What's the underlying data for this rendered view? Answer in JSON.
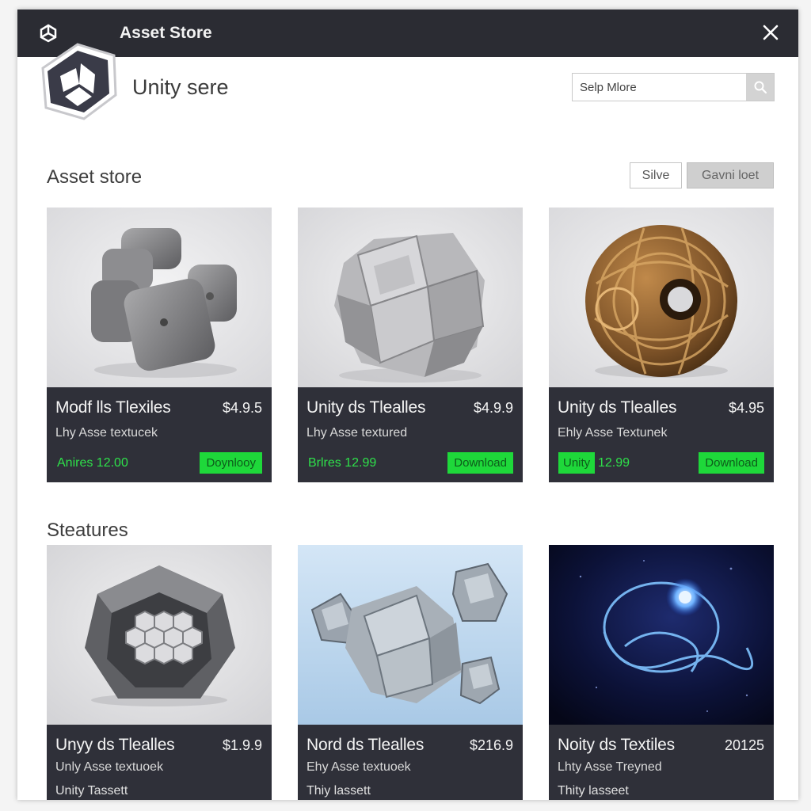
{
  "window": {
    "title": "Asset Store"
  },
  "header": {
    "brand": "Unity sere",
    "search_placeholder": "Selp Mlore"
  },
  "section1": {
    "title": "Asset store",
    "save_label": "Silve",
    "alt_label": "Gavni loet",
    "cards": [
      {
        "name": "Modf lls Tlexiles",
        "price": "$4.9.5",
        "desc": "Lhy Asse textucek",
        "meta": "Anires 12.00",
        "action": "Doynlooy"
      },
      {
        "name": "Unity ds Tlealles",
        "price": "$4.9.9",
        "desc": "Lhy Asse textured",
        "meta": "Brlres 12.99",
        "action": "Download"
      },
      {
        "name": "Unity ds Tlealles",
        "price": "$4.95",
        "desc": "Ehly Asse Textunek",
        "badge": "Unity",
        "meta": "12.99",
        "action": "Download"
      }
    ]
  },
  "section2": {
    "title": "Steatures",
    "cards": [
      {
        "name": "Unyy ds Tlealles",
        "price": "$1.9.9",
        "desc": "Unly Asse textuoek",
        "sub": "Unity Tassett"
      },
      {
        "name": "Nord ds Tlealles",
        "price": "$216.9",
        "desc": "Ehy Asse textuoek",
        "sub": "Thiy lassett"
      },
      {
        "name": "Noity ds Textiles",
        "price": "20125",
        "desc": "Lhty Asse Treyned",
        "sub": "Thity lasseet"
      }
    ]
  },
  "colors": {
    "titlebar": "#2b2c33",
    "card_footer": "#2f3039",
    "accent_green": "#1ed83a"
  }
}
